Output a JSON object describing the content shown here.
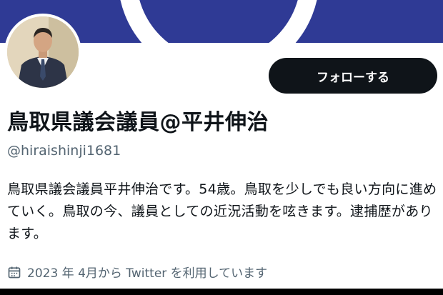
{
  "profile": {
    "follow_label": "フォローする",
    "display_name": "鳥取県議会議員@平井伸治",
    "handle": "@hiraishinji1681",
    "bio": "鳥取県議会議員平井伸治です。54歳。鳥取を少しでも良い方向に進めていく。鳥取の今、議員としての近況活動を呟きます。逮捕歴があります。",
    "joined": "2023 年 4月から Twitter を利用しています"
  },
  "icons": {
    "joined": "calendar-icon"
  },
  "colors": {
    "banner": "#2f3a95",
    "follow_button": "#0f1419",
    "secondary_text": "#536471"
  }
}
